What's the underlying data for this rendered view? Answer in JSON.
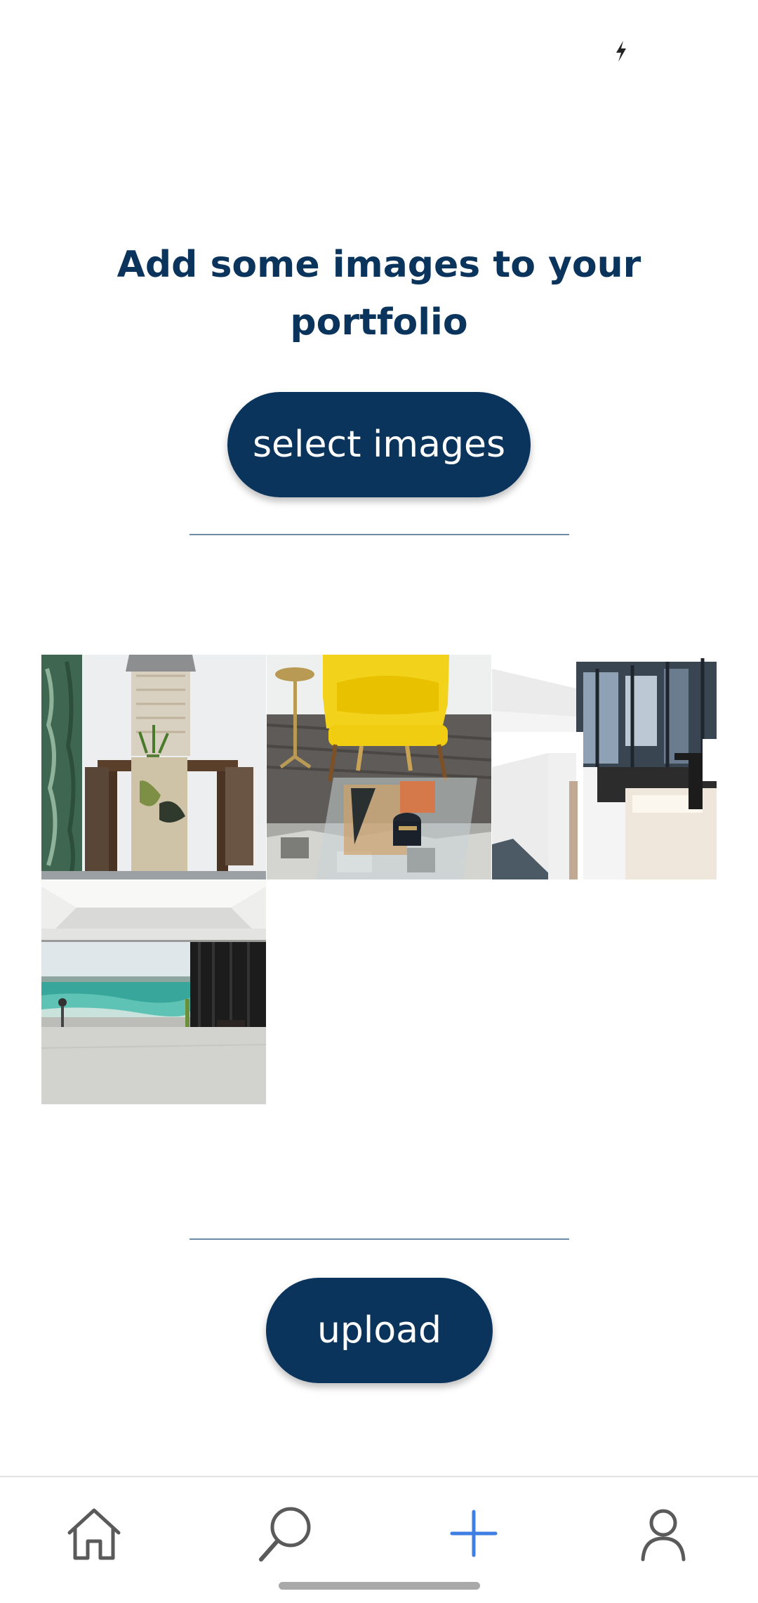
{
  "status_bar": {
    "icon": "flash-icon"
  },
  "main": {
    "heading_line1": "Add some images to your",
    "heading_line2": "portfolio",
    "select_button_label": "select images",
    "upload_button_label": "upload"
  },
  "gallery": {
    "images": [
      {
        "name": "dining-room-photo"
      },
      {
        "name": "yellow-chair-living-room-photo"
      },
      {
        "name": "white-office-interior-photo"
      },
      {
        "name": "sea-view-room-photo"
      }
    ]
  },
  "bottom_nav": {
    "items": [
      {
        "icon": "home-icon"
      },
      {
        "icon": "search-icon"
      },
      {
        "icon": "plus-icon",
        "active": true
      },
      {
        "icon": "user-icon"
      }
    ]
  },
  "colors": {
    "primary": "#0b345c",
    "accent": "#3f7fe3",
    "nav_icon": "#555555",
    "divider": "#6e8ba6"
  }
}
